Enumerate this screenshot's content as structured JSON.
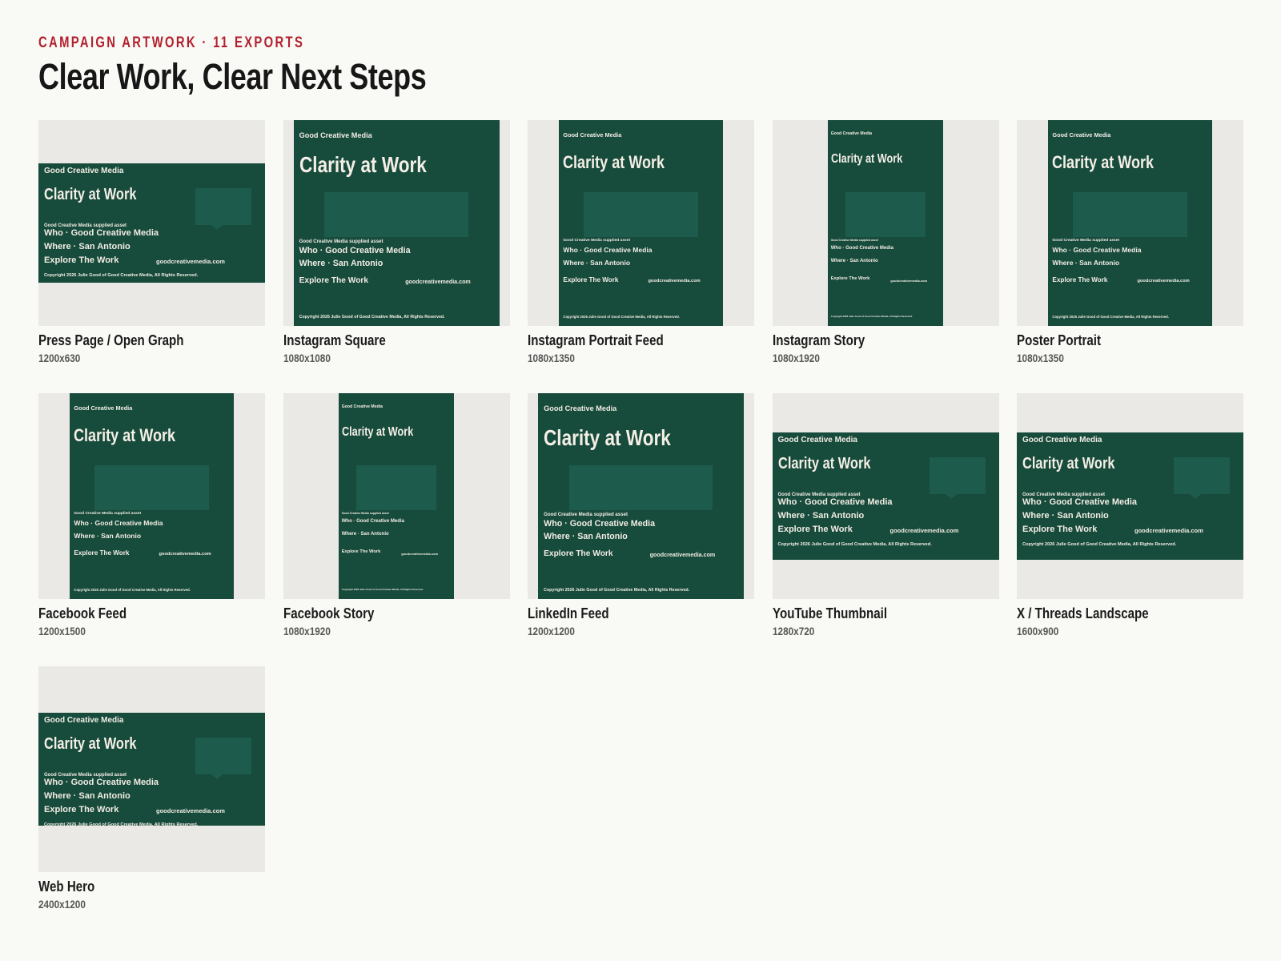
{
  "header": {
    "eyebrow": "CAMPAIGN ARTWORK · 11 EXPORTS",
    "title": "Clear Work, Clear Next Steps"
  },
  "artwork": {
    "brand": "Good Creative Media",
    "headline": "Clarity at Work",
    "supplied": "Good Creative Media supplied asset",
    "who": "Who · Good Creative Media",
    "where": "Where · San Antonio",
    "cta": "Explore The Work",
    "url": "goodcreativemedia.com",
    "copyright": "Copyright 2026 Julie Good of Good Creative Media, All Rights Reserved.",
    "colors": {
      "background": "#174b3c",
      "panel": "#1d5b4c",
      "text": "#f2ede4",
      "accent": "#b2202e"
    },
    "icon": "speech-bubble-ellipsis-icon"
  },
  "exports": [
    {
      "name": "Press Page / Open Graph",
      "size": "1200x630"
    },
    {
      "name": "Instagram Square",
      "size": "1080x1080"
    },
    {
      "name": "Instagram Portrait Feed",
      "size": "1080x1350"
    },
    {
      "name": "Instagram Story",
      "size": "1080x1920"
    },
    {
      "name": "Poster Portrait",
      "size": "1080x1350"
    },
    {
      "name": "Facebook Feed",
      "size": "1200x1500"
    },
    {
      "name": "Facebook Story",
      "size": "1080x1920"
    },
    {
      "name": "LinkedIn Feed",
      "size": "1200x1200"
    },
    {
      "name": "YouTube Thumbnail",
      "size": "1280x720"
    },
    {
      "name": "X / Threads Landscape",
      "size": "1600x900"
    },
    {
      "name": "Web Hero",
      "size": "2400x1200"
    }
  ]
}
